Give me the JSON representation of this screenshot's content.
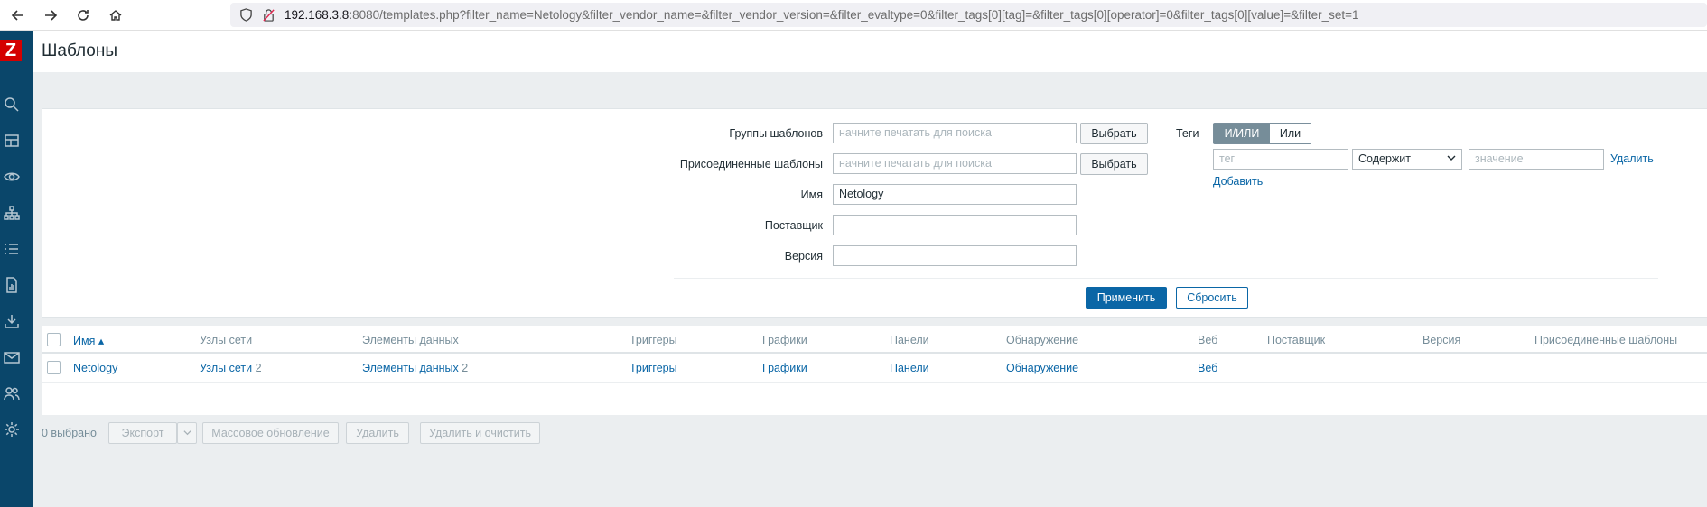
{
  "browser": {
    "url_host": "192.168.3.8",
    "url_rest": ":8080/templates.php?filter_name=Netology&filter_vendor_name=&filter_vendor_version=&filter_evaltype=0&filter_tags[0][tag]=&filter_tags[0][operator]=0&filter_tags[0][value]=&filter_set=1"
  },
  "sidebar": {
    "logo": "Z",
    "icons": [
      "search-icon",
      "dashboard-icon",
      "monitoring-eye-icon",
      "network-icon",
      "list-icon",
      "reports-icon",
      "data-collection-icon",
      "alerts-mail-icon",
      "users-icon",
      "settings-gear-icon"
    ]
  },
  "header": {
    "title": "Шаблоны"
  },
  "filter": {
    "template_groups_label": "Группы шаблонов",
    "template_groups_placeholder": "начните печатать для поиска",
    "linked_templates_label": "Присоединенные шаблоны",
    "linked_templates_placeholder": "начните печатать для поиска",
    "select_label": "Выбрать",
    "name_label": "Имя",
    "name_value": "Netology",
    "vendor_label": "Поставщик",
    "vendor_value": "",
    "version_label": "Версия",
    "version_value": "",
    "tags_label": "Теги",
    "tags_and_or": "И/ИЛИ",
    "tags_or": "Или",
    "tag_placeholder": "тег",
    "operator_value": "Содержит",
    "value_placeholder": "значение",
    "remove_label": "Удалить",
    "add_label": "Добавить",
    "apply_label": "Применить",
    "reset_label": "Сбросить"
  },
  "table": {
    "columns": [
      "Имя ▴",
      "Узлы сети",
      "Элементы данных",
      "Триггеры",
      "Графики",
      "Панели",
      "Обнаружение",
      "Веб",
      "Поставщик",
      "Версия",
      "Присоединенные шаблоны"
    ],
    "rows": [
      {
        "name": "Netology",
        "hosts": "Узлы сети",
        "hosts_count": "2",
        "items": "Элементы данных",
        "items_count": "2",
        "triggers": "Триггеры",
        "graphs": "Графики",
        "dashboards": "Панели",
        "discovery": "Обнаружение",
        "web": "Веб",
        "vendor": "",
        "version": "",
        "linked": ""
      }
    ]
  },
  "footer": {
    "selected": "0 выбрано",
    "export": "Экспорт",
    "mass_update": "Массовое обновление",
    "delete": "Удалить",
    "delete_clear": "Удалить и очистить"
  }
}
